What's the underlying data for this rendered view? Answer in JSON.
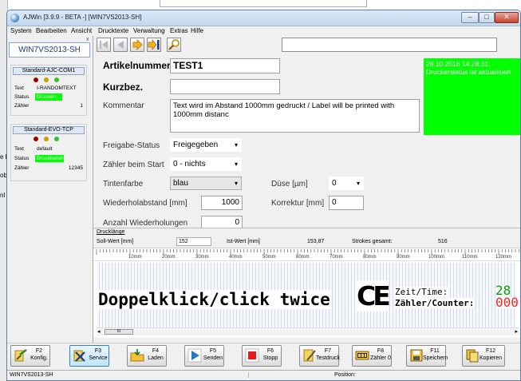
{
  "window": {
    "title": "AJWin [3.9.9 - BETA -] [WIN7VS2013-SH]"
  },
  "menu": [
    "System",
    "Bearbeiten",
    "Ansicht",
    "Drucktexte",
    "Verwaltung",
    "Extras",
    "Hilfe"
  ],
  "background_fragments": [
    "e K",
    "obe",
    "nl K"
  ],
  "sidebar": {
    "header": "WIN7VS2013-SH",
    "close_glyph": "x",
    "printers": [
      {
        "name": "Standard-AJC-COM1",
        "text_label": "Text",
        "text_value": "I-RANDOMTEXT",
        "status_label": "Status",
        "status_value": "Drucken...",
        "counter_label": "Zähler",
        "counter_value": "1"
      },
      {
        "name": "Standard-EVO-TCP",
        "text_label": "Text",
        "text_value": "default",
        "status_label": "Status",
        "status_value": "Druckbereit",
        "counter_label": "Zähler",
        "counter_value": "12345"
      }
    ]
  },
  "toolbar": {
    "search_value": ""
  },
  "form": {
    "artikelnummer_label": "Artikelnummer",
    "artikelnummer_value": "TEST1",
    "kurzbez_label": "Kurzbez.",
    "kurzbez_value": "",
    "kommentar_label": "Kommentar",
    "kommentar_value": "Text wird im Abstand 1000mm gedruckt / Label will be printed with 1000mm distanc",
    "status_box": "28.10.2016 14:28:31: Druckerstatus ist aktualisiert.",
    "freigabe_label": "Freigabe-Status",
    "freigabe_value": "Freigegeben",
    "zaehler_start_label": "Zähler beim Start",
    "zaehler_start_value": "0 - nichts",
    "tintenfarbe_label": "Tintenfarbe",
    "tintenfarbe_value": "blau",
    "duese_label": "Düse [µm]",
    "duese_value": "0",
    "wiederholabstand_label": "Wiederholabstand [mm]",
    "wiederholabstand_value": "1000",
    "korrektur_label": "Korrektur [mm]",
    "korrektur_value": "0",
    "anzahl_label": "Anzahl Wiederholungen",
    "anzahl_value": "0"
  },
  "drucklaenge": {
    "title": "Drucklänge",
    "soll_label": "Soll-Wert [mm]",
    "soll_value": "152",
    "ist_label": "Ist-Wert [mm]",
    "ist_value": "153,87",
    "strokes_label": "Strokes gesamt:",
    "strokes_value": "516"
  },
  "ruler": [
    "10mm",
    "20mm",
    "30mm",
    "40mm",
    "50mm",
    "60mm",
    "70mm",
    "80mm",
    "90mm",
    "100mm",
    "110mm",
    "120mm"
  ],
  "preview": {
    "main_text": "Doppelklick/click twice",
    "ce_mark": "CE",
    "time_label": "Zeit/Time:",
    "counter_label": "Zähler/Counter:",
    "time_value": "28",
    "counter_value": "000",
    "scroll_thumb": "III"
  },
  "fkeys": [
    {
      "key": "F2",
      "label": "Konfig.",
      "icon": "config-icon"
    },
    {
      "key": "F3",
      "label": "Service",
      "icon": "service-icon"
    },
    {
      "key": "F4",
      "label": "Laden",
      "icon": "load-icon"
    },
    {
      "key": "F5",
      "label": "Senden",
      "icon": "send-icon"
    },
    {
      "key": "F6",
      "label": "Stopp",
      "icon": "stop-icon"
    },
    {
      "key": "F7",
      "label": "Testdruck",
      "icon": "testprint-icon"
    },
    {
      "key": "F8",
      "label": "Zähler 0",
      "icon": "counter-reset-icon"
    },
    {
      "key": "F11",
      "label": "Speichern",
      "icon": "save-icon"
    },
    {
      "key": "F12",
      "label": "Kopieren",
      "icon": "copy-icon"
    }
  ],
  "statusbar": {
    "host": "WIN7VS2013-SH",
    "position_label": "Position:"
  },
  "colors": {
    "status_green": "#00ff00",
    "selection_blue": "#3c7fb1",
    "stop_red": "#e31b1b",
    "time_green": "#00a000",
    "counter_red": "#ff2020"
  }
}
